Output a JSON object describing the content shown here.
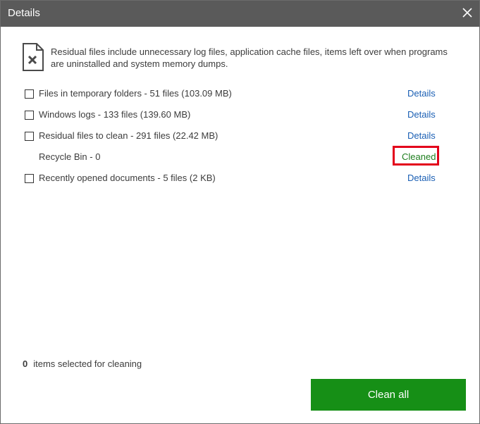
{
  "window": {
    "title": "Details"
  },
  "intro": {
    "text": "Residual files include unnecessary log files, application cache files, items left over when programs are uninstalled and system memory dumps."
  },
  "items": [
    {
      "label": "Files in temporary folders - 51 files (103.09 MB)",
      "checked": false,
      "action": "Details"
    },
    {
      "label": "Windows logs - 133 files (139.60 MB)",
      "checked": false,
      "action": "Details"
    },
    {
      "label": "Residual files to clean - 291 files (22.42 MB)",
      "checked": false,
      "action": "Details"
    },
    {
      "label": "Recycle Bin - 0",
      "status": "Cleaned"
    },
    {
      "label": "Recently opened documents - 5 files (2 KB)",
      "checked": false,
      "action": "Details"
    }
  ],
  "footer": {
    "selected_count": "0",
    "selected_text": "items selected for cleaning",
    "clean_all_label": "Clean all"
  },
  "colors": {
    "titlebar": "#5a5a5a",
    "link": "#1a5fb4",
    "cleaned_text": "#1e7e1e",
    "highlight_border": "#e3001b",
    "primary_button": "#168f16"
  },
  "icons": {
    "close": "close-icon",
    "file_delete": "file-delete-icon"
  }
}
